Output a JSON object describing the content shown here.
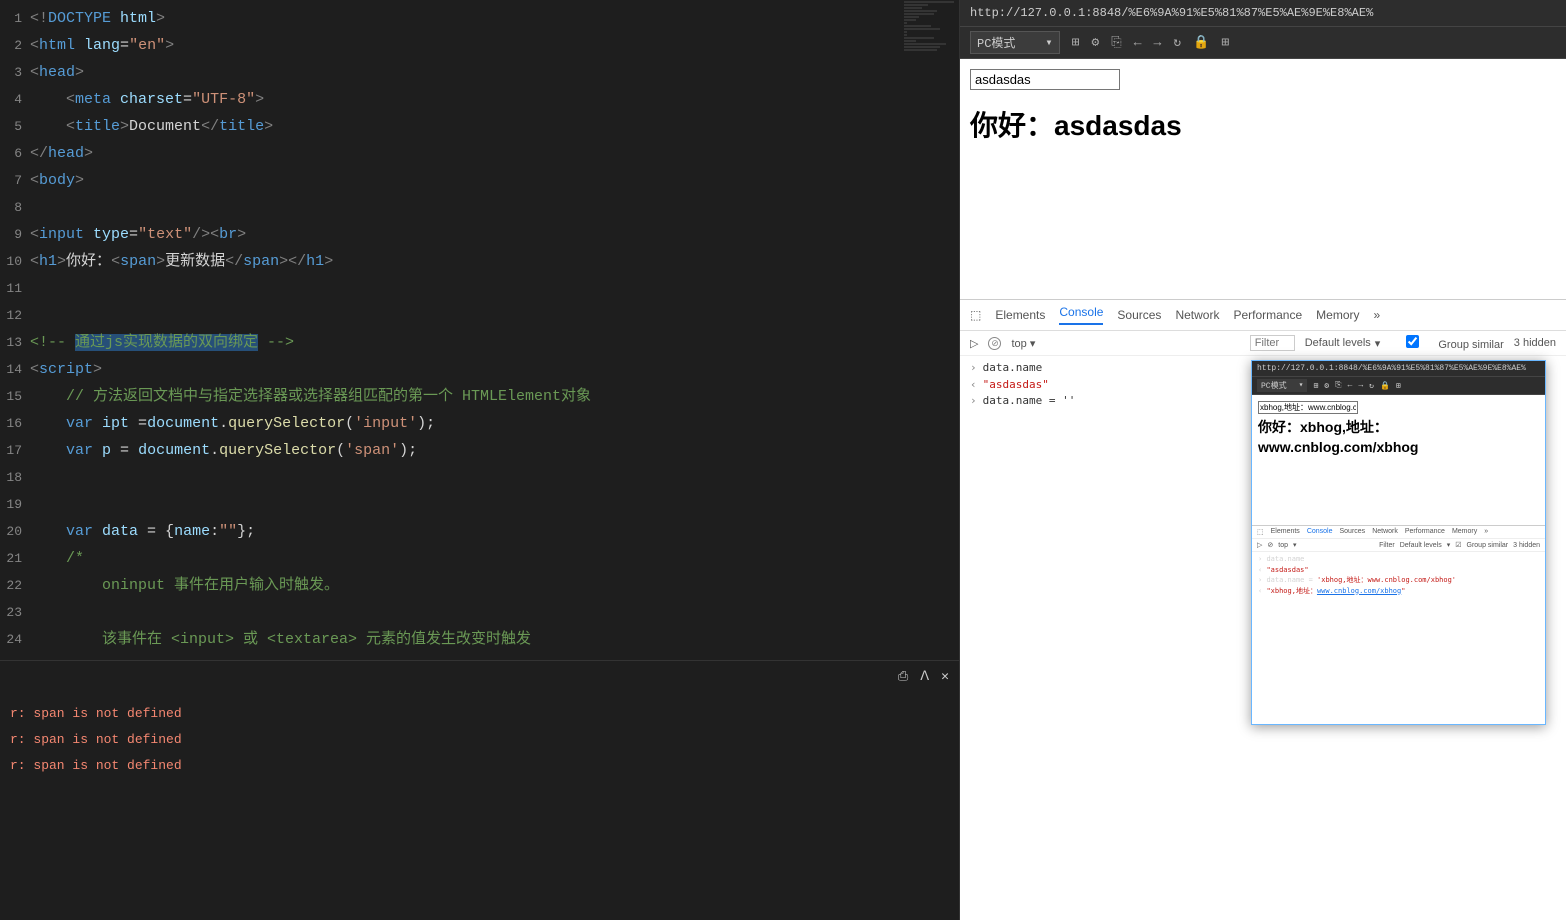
{
  "editor": {
    "lines": [
      "1",
      "2",
      "3",
      "4",
      "5",
      "6",
      "7",
      "8",
      "9",
      "10",
      "11",
      "12",
      "13",
      "14",
      "15",
      "16",
      "17",
      "18",
      "19",
      "20",
      "21",
      "22",
      "23",
      "24"
    ],
    "code": {
      "l1a": "<!",
      "l1b": "DOCTYPE",
      "l1c": " html",
      "l1d": ">",
      "l2a": "<",
      "l2b": "html",
      "l2c": " lang",
      "l2d": "=",
      "l2e": "\"en\"",
      "l2f": ">",
      "l3a": "<",
      "l3b": "head",
      "l3c": ">",
      "l4a": "    <",
      "l4b": "meta",
      "l4c": " charset",
      "l4d": "=",
      "l4e": "\"UTF-8\"",
      "l4f": ">",
      "l5a": "    <",
      "l5b": "title",
      "l5c": ">",
      "l5d": "Document",
      "l5e": "</",
      "l5f": "title",
      "l5g": ">",
      "l6a": "</",
      "l6b": "head",
      "l6c": ">",
      "l7a": "<",
      "l7b": "body",
      "l7c": ">",
      "l9a": "<",
      "l9b": "input",
      "l9c": " type",
      "l9d": "=",
      "l9e": "\"text\"",
      "l9f": "/><",
      "l9g": "br",
      "l9h": ">",
      "l10a": "<",
      "l10b": "h1",
      "l10c": ">",
      "l10d": "你好：",
      "l10e": "<",
      "l10f": "span",
      "l10g": ">",
      "l10h": "更新数据",
      "l10i": "</",
      "l10j": "span",
      "l10k": "></",
      "l10l": "h1",
      "l10m": ">",
      "l13a": "<!-- ",
      "l13b": "通过js实现数据的双向绑定",
      "l13c": " -->",
      "l14a": "<",
      "l14b": "script",
      "l14c": ">",
      "l15a": "    // 方法返回文档中与指定选择器或选择器组匹配的第一个 HTMLElement对象",
      "l16a": "    ",
      "l16b": "var",
      "l16c": " ipt ",
      "l16d": "=",
      "l16e": "document",
      "l16f": ".",
      "l16g": "querySelector",
      "l16h": "(",
      "l16i": "'input'",
      "l16j": ");",
      "l17a": "    ",
      "l17b": "var",
      "l17c": " p ",
      "l17d": "= ",
      "l17e": "document",
      "l17f": ".",
      "l17g": "querySelector",
      "l17h": "(",
      "l17i": "'span'",
      "l17j": ");",
      "l20a": "    ",
      "l20b": "var",
      "l20c": " data ",
      "l20d": "= {",
      "l20e": "name",
      "l20f": ":",
      "l20g": "\"\"",
      "l20h": "};",
      "l21a": "    /*",
      "l22a": "        oninput 事件在用户输入时触发。",
      "l24a": "        该事件在 <input> 或 <textarea> 元素的值发生改变时触发"
    },
    "fold3": "▸",
    "fold14": "▸",
    "fold21": "▸"
  },
  "terminal": {
    "icons": {
      "export": "⎙",
      "up": "ᐱ",
      "close": "✕"
    },
    "err1": "r: span is not defined",
    "err2": "r: span is not defined",
    "err3": "r: span is not defined"
  },
  "browser": {
    "url": "http://127.0.0.1:8848/%E6%9A%91%E5%81%87%E5%AE%9E%E8%AE%",
    "mode": "PC模式",
    "mode_arrow": "▾",
    "icons": {
      "i1": "⊞",
      "i2": "⚙",
      "i3": "⎘",
      "back": "←",
      "fwd": "→",
      "reload": "↻",
      "lock": "🔒",
      "grid": "⊞"
    }
  },
  "preview": {
    "input_value": "asdasdas",
    "h1": "你好：asdasdas"
  },
  "devtools": {
    "selector": "⬚",
    "tabs": {
      "elements": "Elements",
      "console": "Console",
      "sources": "Sources",
      "network": "Network",
      "performance": "Performance",
      "memory": "Memory",
      "more": "»"
    },
    "filter": {
      "play": "▷",
      "stop": "⊘",
      "ctx": "top",
      "ctx_arrow": "▾",
      "filter_ph": "Filter",
      "levels": "Default levels",
      "levels_arrow": "▾",
      "group": "Group similar",
      "hidden": "3 hidden"
    },
    "console": {
      "r1_in": "data.name",
      "r2_out": "\"asdasdas\"",
      "r3_in": "data.name = ''"
    },
    "dock": "⊟"
  },
  "popup": {
    "url": "http://127.0.0.1:8848/%E6%9A%91%E5%81%87%E5%AE%9E%E8%AE%",
    "mode": "PC模式",
    "input_value": "xbhog,地址：www.cnblog.co",
    "h1": "你好：xbhog,地址：www.cnblog.com/xbhog",
    "dt_tabs": {
      "elements": "Elements",
      "console": "Console",
      "sources": "Sources",
      "network": "Network",
      "performance": "Performance",
      "memory": "Memory"
    },
    "dt_filter": {
      "ctx": "top",
      "filter": "Filter",
      "levels": "Default levels",
      "group": "Group similar",
      "hidden": "3 hidden"
    },
    "console": {
      "r1": "data.name",
      "r2": "\"asdasdas\"",
      "r3a": "data.name = ",
      "r3b": "'xbhog,地址：www.cnblog.com/xbhog'",
      "r4a": "\"xbhog,地址：",
      "r4b": "www.cnblog.com/xbhog",
      "r4c": "\""
    }
  }
}
